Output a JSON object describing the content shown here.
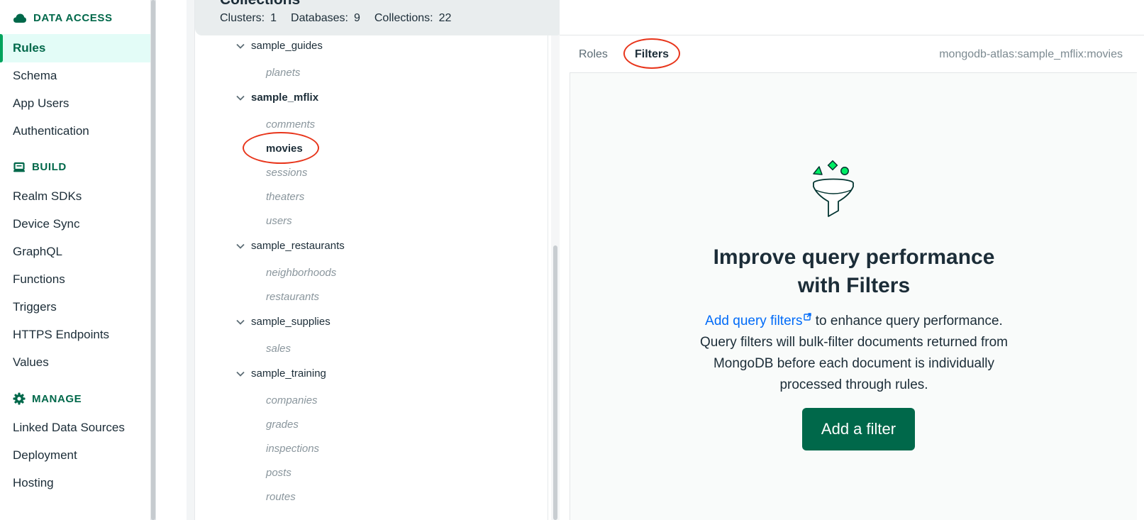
{
  "sidebar": {
    "data_access": {
      "heading": "DATA ACCESS",
      "icon": "cloud-icon",
      "items": [
        {
          "label": "Rules",
          "active": true
        },
        {
          "label": "Schema"
        },
        {
          "label": "App Users"
        },
        {
          "label": "Authentication"
        }
      ]
    },
    "build": {
      "heading": "BUILD",
      "icon": "laptop-icon",
      "items": [
        {
          "label": "Realm SDKs"
        },
        {
          "label": "Device Sync"
        },
        {
          "label": "GraphQL"
        },
        {
          "label": "Functions"
        },
        {
          "label": "Triggers"
        },
        {
          "label": "HTTPS Endpoints"
        },
        {
          "label": "Values"
        }
      ]
    },
    "manage": {
      "heading": "MANAGE",
      "icon": "gear-icon",
      "items": [
        {
          "label": "Linked Data Sources"
        },
        {
          "label": "Deployment"
        },
        {
          "label": "Hosting"
        }
      ]
    }
  },
  "collections": {
    "title": "Collections",
    "stats": {
      "clusters_label": "Clusters:",
      "clusters": "1",
      "databases_label": "Databases:",
      "databases": "9",
      "collections_label": "Collections:",
      "collections": "22"
    },
    "databases": [
      {
        "name": "sample_guides",
        "collections": [
          "planets"
        ]
      },
      {
        "name": "sample_mflix",
        "bold": true,
        "collections": [
          "comments",
          "movies",
          "sessions",
          "theaters",
          "users"
        ],
        "selected": "movies"
      },
      {
        "name": "sample_restaurants",
        "collections": [
          "neighborhoods",
          "restaurants"
        ]
      },
      {
        "name": "sample_supplies",
        "collections": [
          "sales"
        ]
      },
      {
        "name": "sample_training",
        "collections": [
          "companies",
          "grades",
          "inspections",
          "posts",
          "routes"
        ]
      }
    ]
  },
  "right_panel": {
    "tabs": [
      {
        "label": "Roles"
      },
      {
        "label": "Filters",
        "active": true
      }
    ],
    "path": "mongodb-atlas:sample_mflix:movies",
    "illustration": "funnel-icon",
    "empty_state": {
      "title_line1": "Improve query performance",
      "title_line2": "with Filters",
      "link_text": "Add query filters",
      "link_icon": "external-link-icon",
      "desc_rest": " to enhance query performance. Query filters will bulk-filter documents returned from MongoDB before each document is individually processed through rules.",
      "button": "Add a filter"
    }
  },
  "colors": {
    "brand_green": "#00684a",
    "accent_green": "#00a35c",
    "link_blue": "#016bf8",
    "annotation_red": "#e8351b"
  }
}
